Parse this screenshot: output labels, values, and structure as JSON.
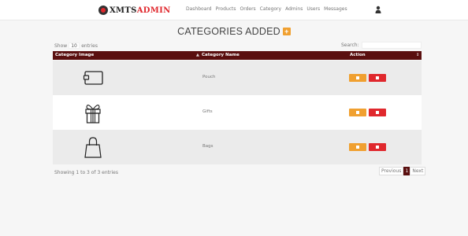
{
  "brand": {
    "part1": "XMTS",
    "part2": "ADMIN"
  },
  "nav": [
    "Dashboard",
    "Products",
    "Orders",
    "Category",
    "Admins",
    "Users",
    "Messages"
  ],
  "title": "CATEGORIES ADDED",
  "add_icon": "plus-icon",
  "show": {
    "prefix": "Show",
    "value": "10",
    "suffix": "entries"
  },
  "search": {
    "label": "Search:",
    "value": ""
  },
  "columns": {
    "image": "Category Image",
    "name": "Category Name",
    "action": "Action"
  },
  "rows": [
    {
      "icon": "pouch-icon",
      "name": "Pouch"
    },
    {
      "icon": "gift-icon",
      "name": "Gifts"
    },
    {
      "icon": "bag-icon",
      "name": "Bags"
    }
  ],
  "info": "Showing 1 to 3 of 3 entries",
  "pagination": {
    "previous": "Previous",
    "current": "1",
    "next": "Next"
  },
  "colors": {
    "header": "#5a0f0f",
    "edit": "#f0a030",
    "delete": "#e0282d",
    "brand_accent": "#e0282d"
  }
}
